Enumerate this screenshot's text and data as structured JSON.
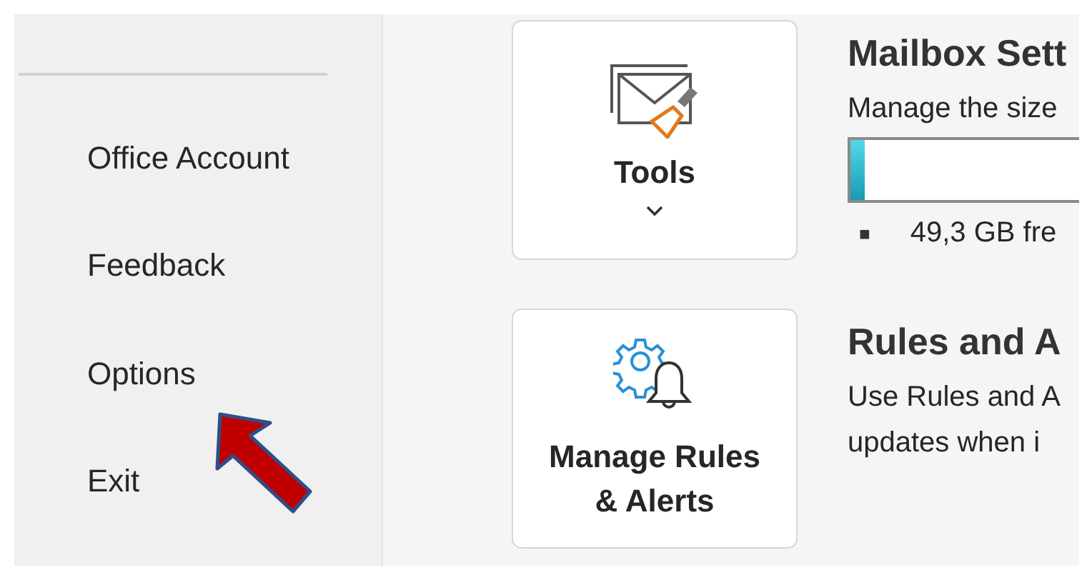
{
  "sidebar": {
    "items": [
      {
        "label": "Office Account"
      },
      {
        "label": "Feedback"
      },
      {
        "label": "Options"
      },
      {
        "label": "Exit"
      }
    ]
  },
  "cards": [
    {
      "kind": "tools",
      "label": "Tools",
      "heading": "Mailbox Sett",
      "lines": [
        "Manage the size"
      ],
      "storage": {
        "level": 0.06
      },
      "bullet": "■",
      "note": "49,3 GB fre"
    },
    {
      "kind": "rules",
      "label_lines": [
        "Manage Rules",
        "& Alerts"
      ],
      "heading": "Rules and A",
      "lines": [
        "Use Rules and A",
        "updates when i"
      ]
    }
  ]
}
